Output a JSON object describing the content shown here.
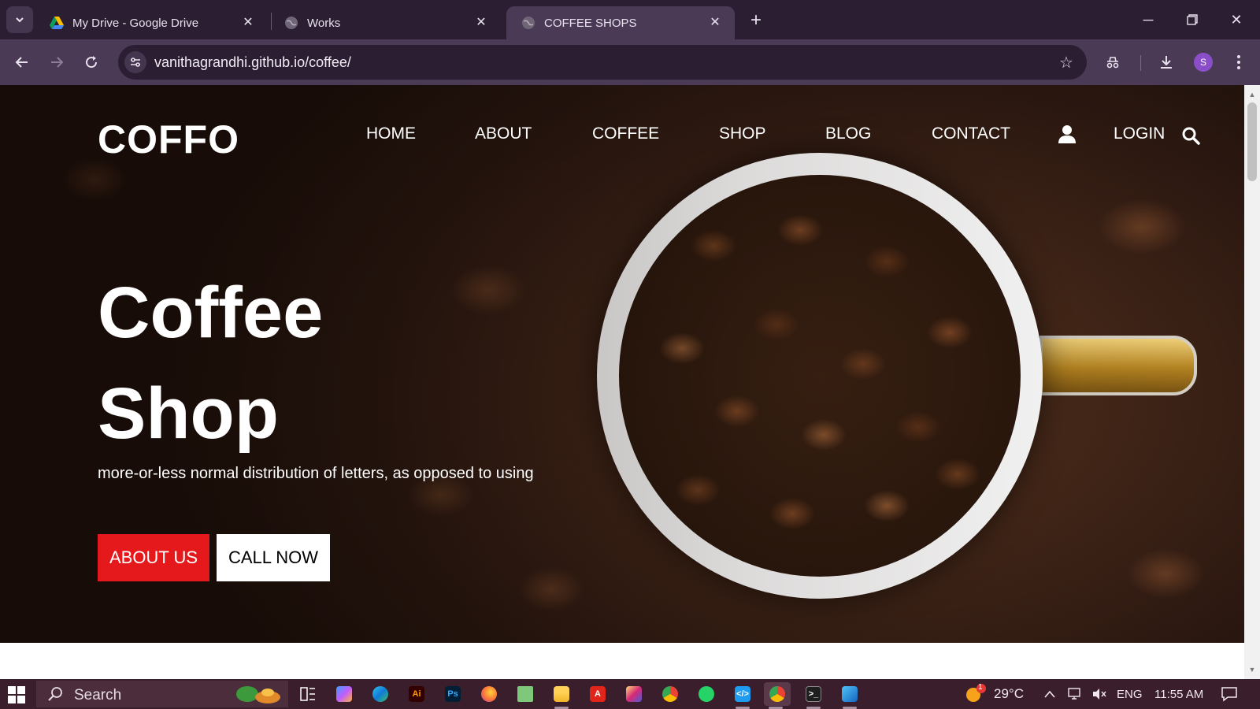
{
  "browser": {
    "tabs": [
      {
        "title": "My Drive - Google Drive",
        "icon": "google-drive-icon",
        "active": false
      },
      {
        "title": "Works",
        "icon": "globe-icon",
        "active": false
      },
      {
        "title": "COFFEE SHOPS",
        "icon": "globe-icon",
        "active": true
      }
    ],
    "address": "vanithagrandhi.github.io/coffee/",
    "profile_initial": "S"
  },
  "site": {
    "logo": "COFFO",
    "nav": [
      {
        "label": "HOME"
      },
      {
        "label": "ABOUT"
      },
      {
        "label": "COFFEE"
      },
      {
        "label": "SHOP"
      },
      {
        "label": "BLOG"
      },
      {
        "label": "CONTACT"
      }
    ],
    "login_label": "LOGIN",
    "hero": {
      "title_line1": "Coffee",
      "title_line2": "Shop",
      "subtitle": "more-or-less normal distribution of letters, as opposed to using",
      "primary_button": "ABOUT US",
      "secondary_button": "CALL NOW"
    },
    "colors": {
      "primary_button_bg": "#e5191c",
      "secondary_button_bg": "#ffffff"
    }
  },
  "taskbar": {
    "search_placeholder": "Search",
    "weather": "29°C",
    "weather_badge": "1",
    "language": "ENG",
    "time": "11:55 AM",
    "apps": [
      "task-view-icon",
      "copilot-icon",
      "edge-icon",
      "illustrator-icon",
      "photoshop-icon",
      "firefox-icon",
      "notepad-icon",
      "file-explorer-icon",
      "acrobat-icon",
      "instagram-icon",
      "chrome-icon",
      "whatsapp-icon",
      "vscode-icon",
      "chrome-profile-icon",
      "terminal-icon",
      "photos-icon"
    ]
  }
}
